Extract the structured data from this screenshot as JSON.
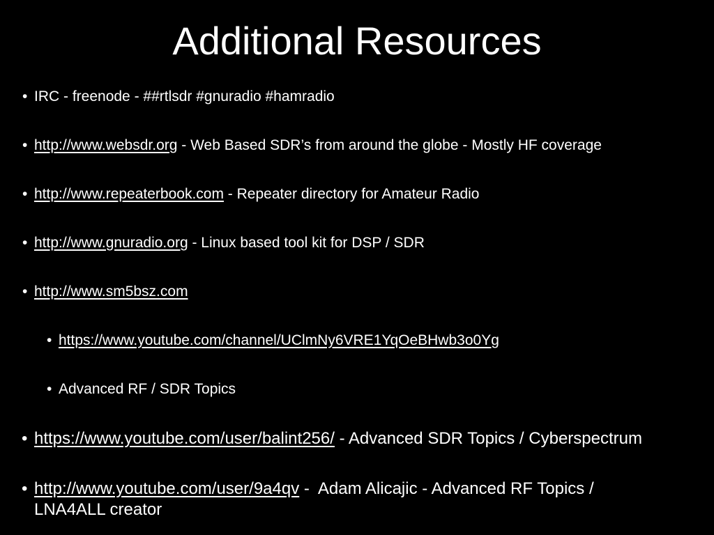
{
  "title": "Additional Resources",
  "bullet": "•",
  "items": [
    {
      "link": "",
      "text": "IRC - freenode - ##rtlsdr #gnuradio #hamradio"
    },
    {
      "link": "http://www.websdr.org",
      "text": " - Web Based SDR’s from around the globe - Mostly HF coverage"
    },
    {
      "link": "http://www.repeaterbook.com",
      "text": " - Repeater directory for Amateur Radio"
    },
    {
      "link": "http://www.gnuradio.org",
      "text": " - Linux based tool kit for DSP / SDR"
    },
    {
      "link": "http://www.sm5bsz.com",
      "text": ""
    },
    {
      "link": "https://www.youtube.com/channel/UClmNy6VRE1YqOeBHwb3o0Yg",
      "text": ""
    },
    {
      "link": "",
      "text": "Advanced RF / SDR Topics"
    },
    {
      "link": "https://www.youtube.com/user/balint256/",
      "text": " - Advanced SDR Topics / Cyberspectrum"
    },
    {
      "link": "http://www.youtube.com/user/9a4qv",
      "text": " -  Adam Alicajic - Advanced RF Topics / LNA4ALL creator"
    }
  ]
}
